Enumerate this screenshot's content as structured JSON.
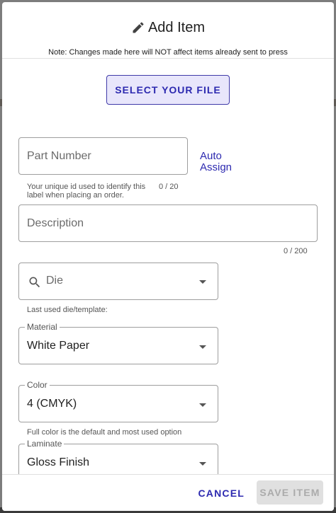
{
  "dialog": {
    "title": "Add Item",
    "note": "Note: Changes made here will NOT affect items already sent to press",
    "file_button_label": "SELECT YOUR FILE"
  },
  "part_number": {
    "placeholder": "Part Number",
    "helper": "Your unique id used to identify this label when placing an order.",
    "counter": "0 / 20",
    "auto_assign_label": "Auto Assign"
  },
  "description": {
    "placeholder": "Description",
    "counter": "0 / 200"
  },
  "die": {
    "placeholder": "Die",
    "helper": "Last used die/template:"
  },
  "material": {
    "label": "Material",
    "value": "White Paper"
  },
  "color": {
    "label": "Color",
    "value": "4 (CMYK)",
    "helper": "Full color is the default and most used option"
  },
  "laminate": {
    "label": "Laminate",
    "value": "Gloss Finish"
  },
  "footer": {
    "cancel_label": "CANCEL",
    "save_label": "SAVE ITEM"
  },
  "icons": {
    "title_icon": "pencil-icon",
    "die_icon": "search-icon",
    "select_icon": "chevron-down-icon"
  },
  "colors": {
    "accent": "#2d2ab0",
    "file_button_bg": "#e8e6fb",
    "disabled_bg": "#e0e0e0"
  }
}
